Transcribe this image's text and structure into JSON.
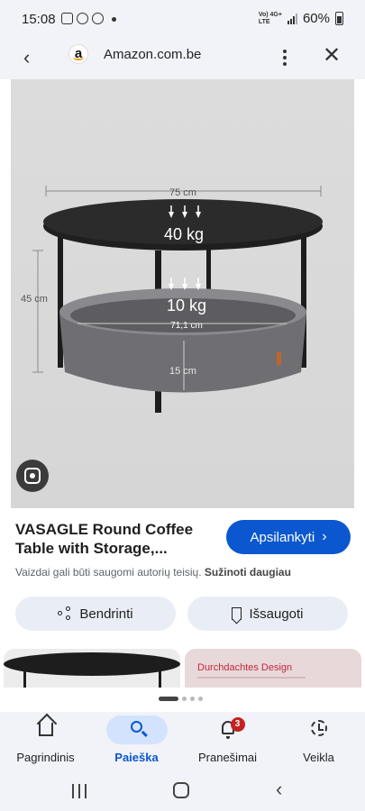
{
  "status_bar": {
    "time": "15:08",
    "network": "Vo) 4G+\nLTE",
    "battery": "60%"
  },
  "browser": {
    "site_logo_letter": "a",
    "url": "Amazon.com.be",
    "back_icon": "arrow-left-icon",
    "menu_icon": "more-vert-icon",
    "close_icon": "close-icon"
  },
  "image": {
    "width_label": "75 cm",
    "top_load": "40 kg",
    "height_label": "45 cm",
    "shelf_load": "10 kg",
    "basket_width_label": "71,1 cm",
    "basket_depth_label": "15 cm",
    "lens_icon": "google-lens-icon"
  },
  "product": {
    "title": "VASAGLE Round Coffee Table with Storage,...",
    "visit_label": "Apsilankyti",
    "copyright_text": "Vaizdai gali būti saugomi autorių teisių.",
    "learn_more": "Sužinoti daugiau"
  },
  "actions": {
    "share_label": "Bendrinti",
    "save_label": "Išsaugoti"
  },
  "thumbnails": {
    "second_label": "Durchdachtes Design"
  },
  "bottom_nav": {
    "items": [
      {
        "label": "Pagrindinis",
        "icon": "home-icon"
      },
      {
        "label": "Paieška",
        "icon": "search-icon"
      },
      {
        "label": "Pranešimai",
        "icon": "bell-icon",
        "badge": "3"
      },
      {
        "label": "Veikla",
        "icon": "activity-icon"
      }
    ],
    "active_index": 1
  },
  "colors": {
    "accent": "#0b57d0",
    "chip_bg": "#e9eef6",
    "badge": "#c5221f"
  }
}
